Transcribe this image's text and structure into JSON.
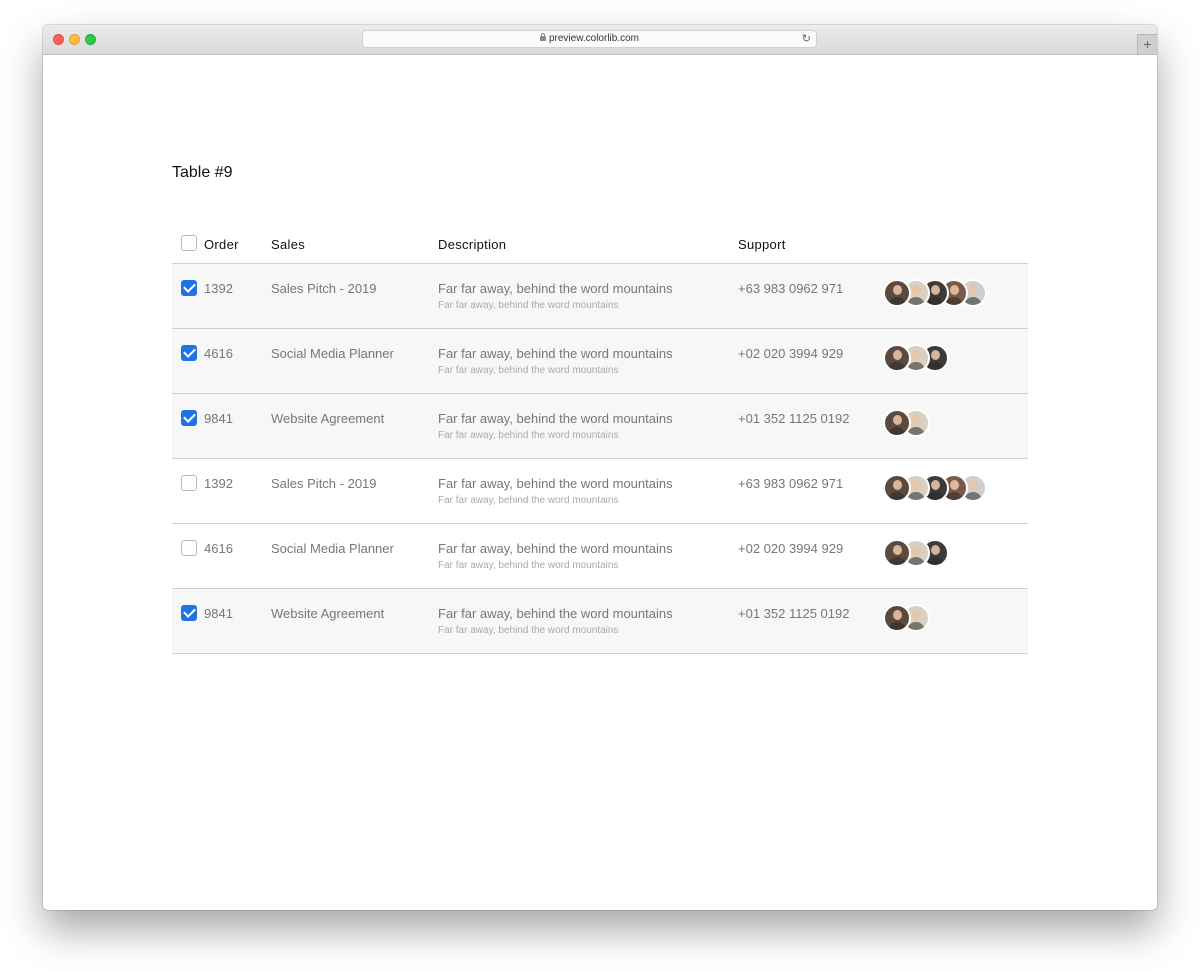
{
  "browser": {
    "url": "preview.colorlib.com",
    "newtab_label": "+"
  },
  "page": {
    "title": "Table #9"
  },
  "table": {
    "headers": {
      "order": "Order",
      "sales": "Sales",
      "description": "Description",
      "support": "Support"
    },
    "header_checked": false,
    "rows": [
      {
        "checked": true,
        "order": "1392",
        "sales": "Sales Pitch - 2019",
        "desc_main": "Far far away, behind the word mountains",
        "desc_sub": "Far far away, behind the word mountains",
        "support": "+63 983 0962 971",
        "avatars": 5
      },
      {
        "checked": true,
        "order": "4616",
        "sales": "Social Media Planner",
        "desc_main": "Far far away, behind the word mountains",
        "desc_sub": "Far far away, behind the word mountains",
        "support": "+02 020 3994 929",
        "avatars": 3
      },
      {
        "checked": true,
        "order": "9841",
        "sales": "Website Agreement",
        "desc_main": "Far far away, behind the word mountains",
        "desc_sub": "Far far away, behind the word mountains",
        "support": "+01 352 1125 0192",
        "avatars": 2
      },
      {
        "checked": false,
        "order": "1392",
        "sales": "Sales Pitch - 2019",
        "desc_main": "Far far away, behind the word mountains",
        "desc_sub": "Far far away, behind the word mountains",
        "support": "+63 983 0962 971",
        "avatars": 5
      },
      {
        "checked": false,
        "order": "4616",
        "sales": "Social Media Planner",
        "desc_main": "Far far away, behind the word mountains",
        "desc_sub": "Far far away, behind the word mountains",
        "support": "+02 020 3994 929",
        "avatars": 3
      },
      {
        "checked": true,
        "order": "9841",
        "sales": "Website Agreement",
        "desc_main": "Far far away, behind the word mountains",
        "desc_sub": "Far far away, behind the word mountains",
        "support": "+01 352 1125 0192",
        "avatars": 2
      }
    ]
  },
  "colors": {
    "accent": "#1f74e4",
    "row_shade": "#f7f7f7",
    "avatar_tones": [
      "#5b4a3d",
      "#d9cfc2",
      "#3e3a38",
      "#7a5a4c",
      "#cfcfcf"
    ]
  }
}
